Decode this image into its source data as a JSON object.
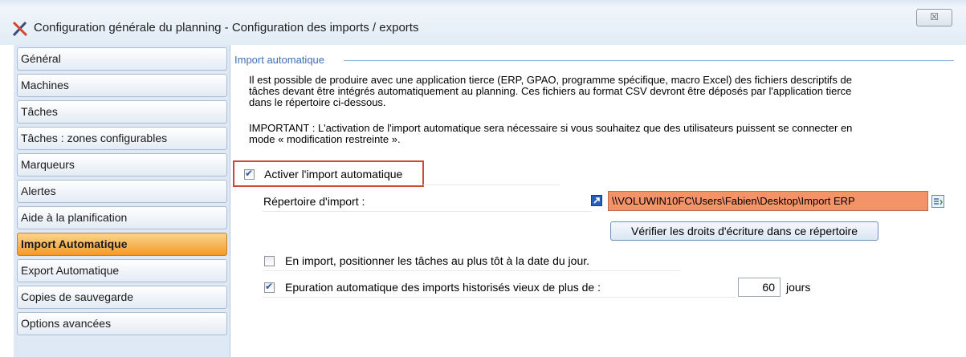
{
  "window": {
    "title": "Configuration générale du planning - Configuration des imports / exports",
    "close_glyph": "☒"
  },
  "sidebar": {
    "items": [
      {
        "label": "Général"
      },
      {
        "label": "Machines"
      },
      {
        "label": "Tâches"
      },
      {
        "label": "Tâches : zones configurables"
      },
      {
        "label": "Marqueurs"
      },
      {
        "label": "Alertes"
      },
      {
        "label": "Aide à la planification"
      },
      {
        "label": "Import Automatique"
      },
      {
        "label": "Export Automatique"
      },
      {
        "label": "Copies de sauvegarde"
      },
      {
        "label": "Options avancées"
      }
    ],
    "active_index": 7
  },
  "import": {
    "section_title": "Import automatique",
    "desc_line1": "Il est possible de produire avec une application tierce (ERP, GPAO, programme spécifique, macro Excel) des fichiers descriptifs de",
    "desc_line2": "tâches devant être intégrés automatiquement au planning. Ces fichiers au format CSV devront être déposés par l'application tierce",
    "desc_line3": "dans le répertoire ci-dessous.",
    "important_line1": "IMPORTANT : L'activation de l'import automatique sera nécessaire si vous souhaitez que des utilisateurs puissent se connecter en",
    "important_line2": "mode « modification restreinte ».",
    "enable_label": "Activer l'import automatique",
    "enable_checked": true,
    "directory_label": "Répertoire d'import :",
    "directory_value": "\\\\VOLUWIN10FC\\Users\\Fabien\\Desktop\\Import ERP",
    "verify_button": "Vérifier les droits d'écriture dans ce répertoire",
    "position_label": "En import, positionner les tâches au plus tôt à la date du jour.",
    "position_checked": false,
    "purge_label": "Epuration automatique des imports historisés vieux de plus de :",
    "purge_checked": true,
    "purge_days": "60",
    "purge_unit": "jours"
  },
  "colors": {
    "accent": "#3f6fb5",
    "active_tab": "#f39b2a",
    "path_field": "#f4926a",
    "highlight": "#cf4a32"
  }
}
